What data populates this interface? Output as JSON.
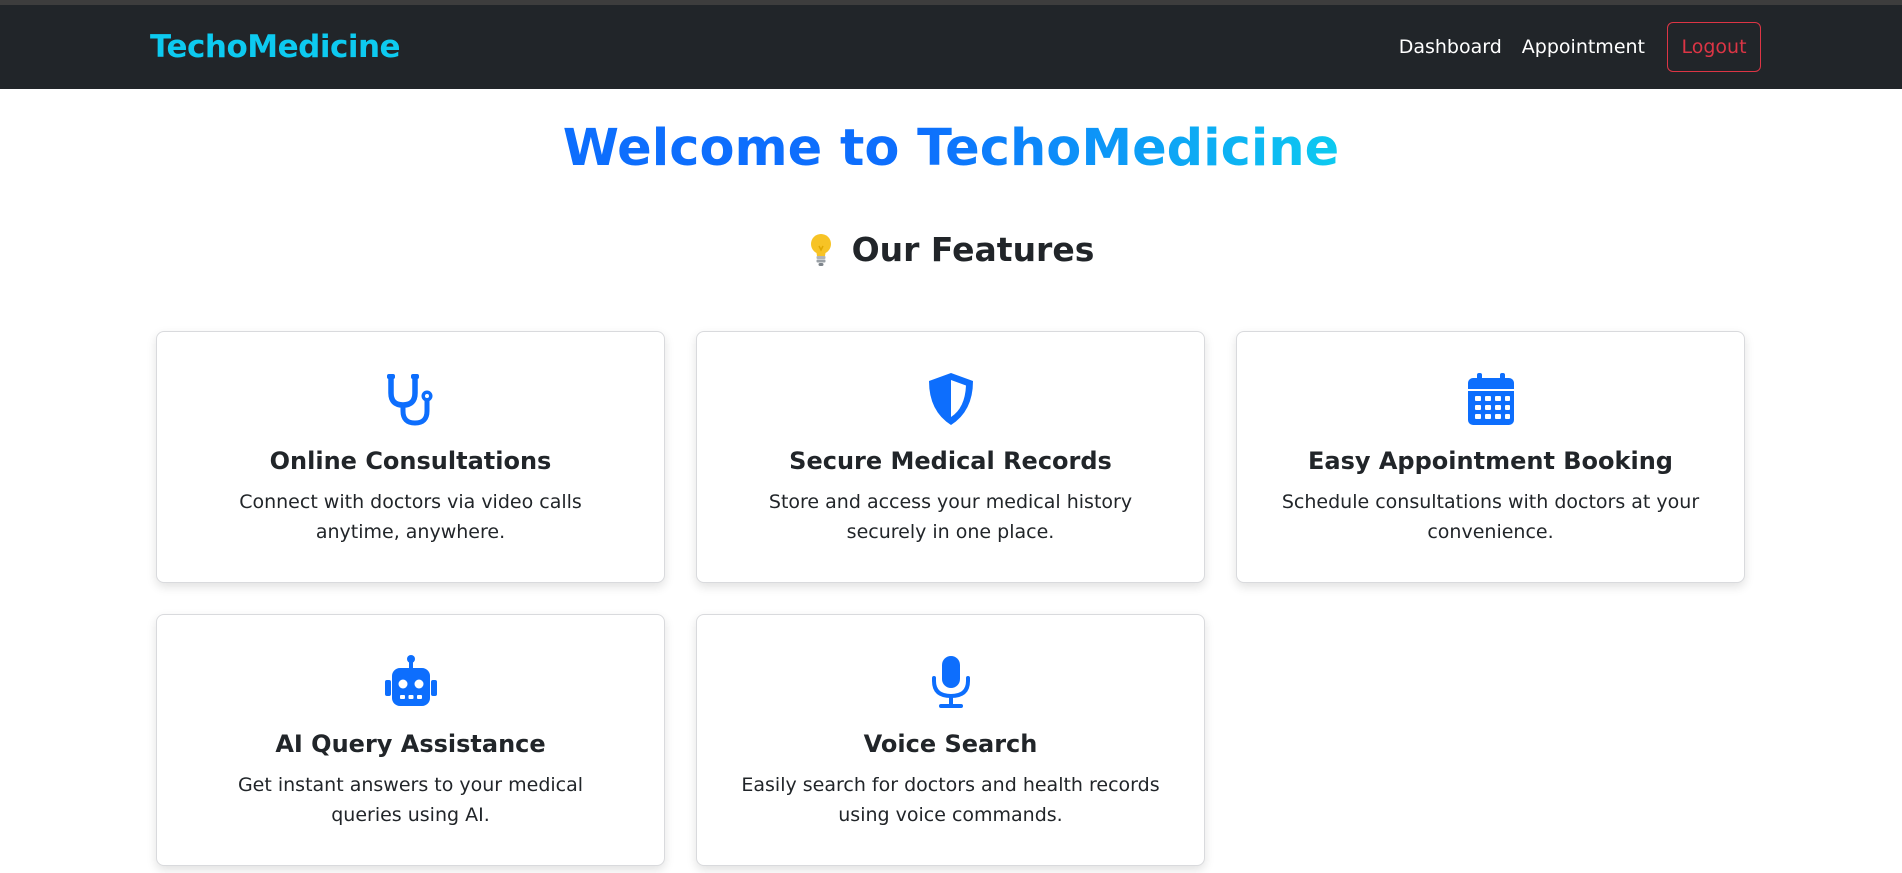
{
  "navbar": {
    "brand": "TechoMedicine",
    "links": [
      "Dashboard",
      "Appointment"
    ],
    "logout_label": "Logout"
  },
  "hero": {
    "welcome": "Welcome to ",
    "brand": "TechoMedicine"
  },
  "features": {
    "icon": "lightbulb-icon",
    "title": "Our Features",
    "items": [
      {
        "icon": "stethoscope-icon",
        "title": "Online Consultations",
        "description": "Connect with doctors via video calls anytime, anywhere."
      },
      {
        "icon": "shield-icon",
        "title": "Secure Medical Records",
        "description": "Store and access your medical history securely in one place."
      },
      {
        "icon": "calendar-icon",
        "title": "Easy Appointment Booking",
        "description": "Schedule consultations with doctors at your convenience."
      },
      {
        "icon": "robot-icon",
        "title": "AI Query Assistance",
        "description": "Get instant answers to your medical queries using AI."
      },
      {
        "icon": "microphone-icon",
        "title": "Voice Search",
        "description": "Easily search for doctors and health records using voice commands."
      }
    ]
  },
  "colors": {
    "navbar_bg": "#212529",
    "brand": "#0dcaf0",
    "primary": "#0d6efd",
    "danger": "#dc3545"
  }
}
